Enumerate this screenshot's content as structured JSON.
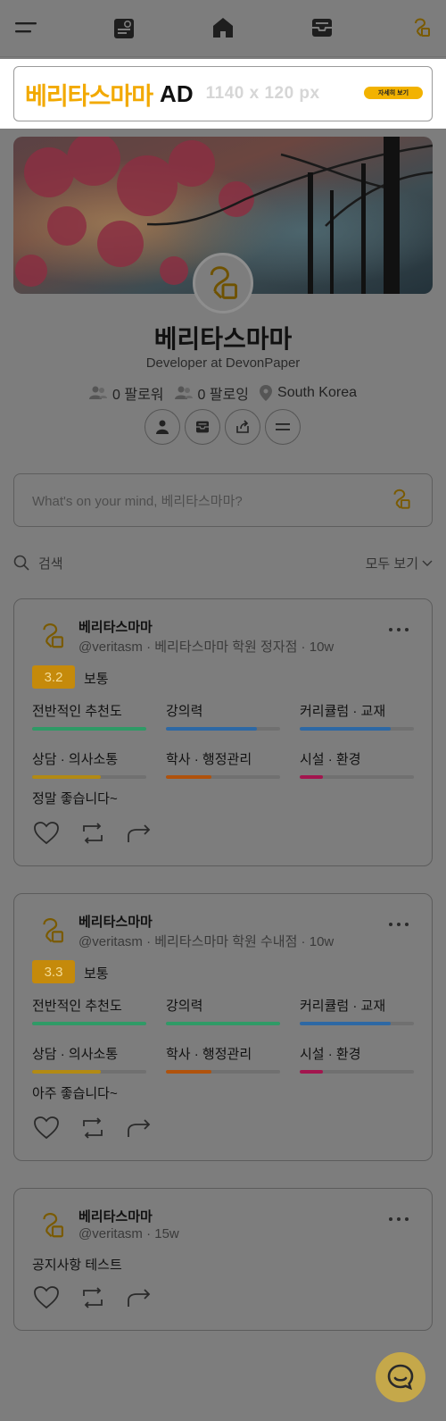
{
  "nav": {
    "items": [
      "menu-icon",
      "profile-card-icon",
      "home-icon",
      "inbox-icon",
      "brand-logo-icon"
    ]
  },
  "ad": {
    "brand": "베리타스마마",
    "tag": "AD",
    "size_text": "1140 x 120 px",
    "cta": "자세히 보기"
  },
  "profile": {
    "name": "베리타스마마",
    "bio": "Developer at DevonPaper",
    "followers": "0 팔로워",
    "following": "0 팔로잉",
    "location": "South Korea"
  },
  "compose": {
    "placeholder": "What's on your mind, 베리타스마마?"
  },
  "feed": {
    "search_label": "검색",
    "view_all": "모두 보기"
  },
  "posts": [
    {
      "author": "베리타스마마",
      "handle": "@veritasm",
      "school": "베리타스마마 학원 정자점",
      "time": "10w",
      "score": "3.2",
      "score_text": "보통",
      "categories": [
        {
          "label": "전반적인 추천도",
          "value": 1.0,
          "color": "#2f9a66"
        },
        {
          "label": "강의력",
          "value": 0.8,
          "color": "#2d68a4"
        },
        {
          "label": "커리큘럼 · 교재",
          "value": 0.8,
          "color": "#2d68a4"
        },
        {
          "label": "상담 · 의사소통",
          "value": 0.6,
          "color": "#b28a14"
        },
        {
          "label": "학사 · 행정관리",
          "value": 0.4,
          "color": "#b0520c"
        },
        {
          "label": "시설 · 환경",
          "value": 0.2,
          "color": "#a3154e"
        }
      ],
      "body": "정말 좋습니다~"
    },
    {
      "author": "베리타스마마",
      "handle": "@veritasm",
      "school": "베리타스마마 학원 수내점",
      "time": "10w",
      "score": "3.3",
      "score_text": "보통",
      "categories": [
        {
          "label": "전반적인 추천도",
          "value": 1.0,
          "color": "#2f9a66"
        },
        {
          "label": "강의력",
          "value": 1.0,
          "color": "#2f9a66"
        },
        {
          "label": "커리큘럼 · 교재",
          "value": 0.8,
          "color": "#2d68a4"
        },
        {
          "label": "상담 · 의사소통",
          "value": 0.6,
          "color": "#b28a14"
        },
        {
          "label": "학사 · 행정관리",
          "value": 0.4,
          "color": "#b0520c"
        },
        {
          "label": "시설 · 환경",
          "value": 0.2,
          "color": "#a3154e"
        }
      ],
      "body": "아주 좋습니다~"
    },
    {
      "author": "베리타스마마",
      "handle": "@veritasm",
      "time": "15w",
      "body": "공지사항 테스트"
    }
  ],
  "colors": {
    "overlay": "#7d7d7d",
    "brand_yellow": "#f2a900"
  }
}
